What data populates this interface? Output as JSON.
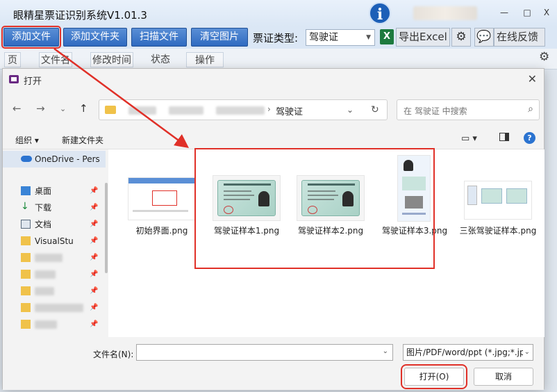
{
  "app": {
    "title": "眼精星票证识别系统V1.01.3",
    "logo_letter": "i",
    "window_controls": [
      "—",
      "□",
      "X"
    ],
    "toolbar": {
      "add_file": "添加文件",
      "add_folder": "添加文件夹",
      "scan_file": "扫描文件",
      "clear_images": "清空图片",
      "cert_type_label": "票证类型:",
      "cert_type_value": "驾驶证",
      "excel_icon_letter": "X",
      "export_excel": "导出Excel",
      "online_feedback": "在线反馈"
    },
    "table_headers": [
      "页码",
      "文件名",
      "修改时间",
      "状态",
      "操作"
    ]
  },
  "dialog": {
    "title": "打开",
    "address": {
      "current_folder": "驾驶证"
    },
    "search_placeholder": "在 驾驶证 中搜索",
    "organize": "组织 ▾",
    "new_folder": "新建文件夹",
    "help_glyph": "?",
    "nav_items": [
      {
        "label": "OneDrive - Pers",
        "icon": "cloud-icon"
      },
      {
        "label": "桌面",
        "icon": "desktop-icon",
        "pinned": true
      },
      {
        "label": "下载",
        "icon": "download-icon",
        "pinned": true
      },
      {
        "label": "文档",
        "icon": "document-icon",
        "pinned": true
      },
      {
        "label": "VisualStu",
        "icon": "folder-icon",
        "pinned": true
      }
    ],
    "files": [
      {
        "name": "初始界面.png",
        "kind": "screenshot"
      },
      {
        "name": "驾驶证样本1.png",
        "kind": "license"
      },
      {
        "name": "驾驶证样本2.png",
        "kind": "license"
      },
      {
        "name": "驾驶证样本3.png",
        "kind": "license-portrait"
      },
      {
        "name": "三张驾驶证样本.png",
        "kind": "collage"
      }
    ],
    "filename_label": "文件名(N):",
    "filename_value": "",
    "filetype_value": "图片/PDF/word/ppt (*.jpg;*.jp",
    "open_button": "打开(O)",
    "cancel_button": "取消"
  },
  "colors": {
    "accent_red": "#e03028",
    "toolbar_blue": "#2f6ac0"
  }
}
